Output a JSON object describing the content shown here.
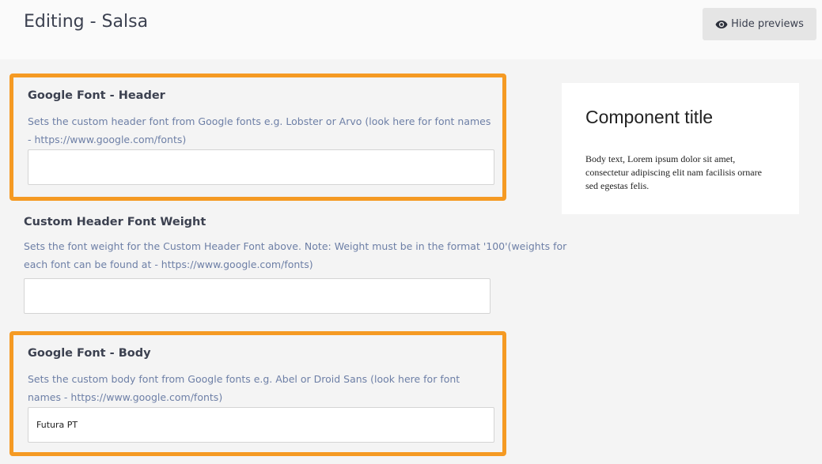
{
  "header": {
    "title": "Editing - Salsa",
    "hide_previews_label": "Hide previews"
  },
  "fields": [
    {
      "label": "Google Font - Header",
      "description": "Sets the custom header font from Google fonts e.g. Lobster or Arvo (look here for font names - https://www.google.com/fonts)",
      "value": "",
      "highlighted": true
    },
    {
      "label": "Custom Header Font Weight",
      "description": "Sets the font weight for the Custom Header Font above. Note: Weight must be in the format '100'(weights for each font can be found at - https://www.google.com/fonts)",
      "value": "",
      "highlighted": false
    },
    {
      "label": "Google Font - Body",
      "description": "Sets the custom body font from Google fonts e.g. Abel or Droid Sans (look here for font names - https://www.google.com/fonts)",
      "value": "Futura PT",
      "highlighted": true
    }
  ],
  "preview": {
    "title": "Component title",
    "body": "Body text, Lorem ipsum dolor sit amet, consectetur adipiscing elit nam facilisis ornare sed egestas felis."
  },
  "icons": {
    "hide_previews": "eye-icon"
  },
  "colors": {
    "highlight": "#f59a23",
    "description_text": "#6d7fa6",
    "label_text": "#3c4150"
  }
}
